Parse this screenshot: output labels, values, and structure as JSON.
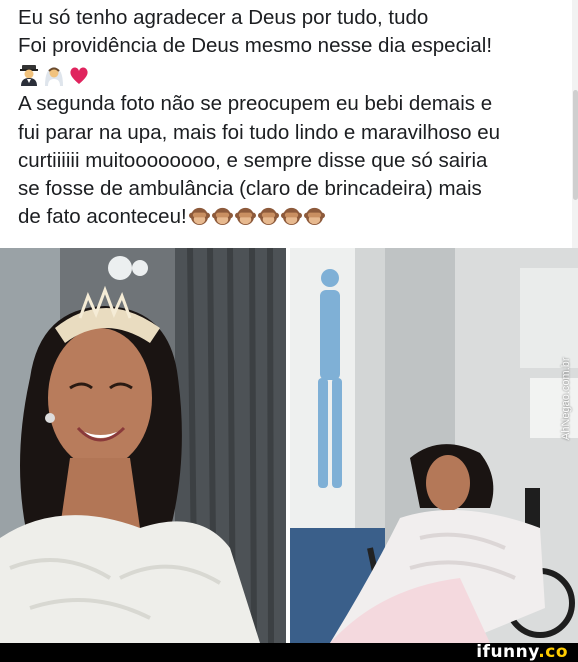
{
  "post": {
    "lines": [
      "Eu só tenho agradecer a Deus por tudo, tudo",
      "Foi providência de Deus mesmo nesse dia especial!",
      "A segunda foto não se preocupem eu bebi demais e",
      "fui parar na upa, mais foi tudo lindo e maravilhoso eu",
      "curtiiiiii muitoooooooo, e sempre disse que só sairia",
      "se fosse de ambulância (claro de brincadeira) mais",
      "de fato aconteceu!"
    ],
    "emoji_row": [
      "groom-emoji",
      "bride-emoji",
      "red-heart-emoji"
    ],
    "trailing_emojis": [
      "see-no-evil-monkey",
      "see-no-evil-monkey",
      "see-no-evil-monkey",
      "see-no-evil-monkey",
      "see-no-evil-monkey",
      "see-no-evil-monkey"
    ]
  },
  "photos": {
    "left": "bride-with-tiara-photo",
    "right": "bride-in-wheelchair-photo"
  },
  "watermark": "AhNegao.com.br",
  "footer": {
    "logo_main": "ifunny",
    "logo_suffix": ".co"
  },
  "colors": {
    "text": "#1c1e21",
    "footer_bg": "#000000",
    "heart": "#e0245e",
    "logo_accent": "#ffcc00"
  }
}
